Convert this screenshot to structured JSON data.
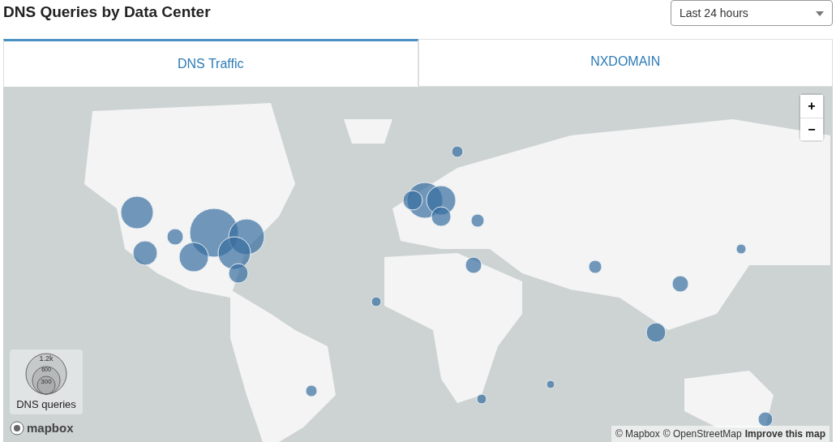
{
  "title": "DNS Queries by Data Center",
  "range_select": {
    "value": "Last 24 hours"
  },
  "tabs": [
    {
      "label": "DNS Traffic",
      "selected": true
    },
    {
      "label": "NXDOMAIN",
      "selected": false
    }
  ],
  "map": {
    "zoom_in": "+",
    "zoom_out": "−",
    "legend": {
      "sizes": [
        "1.2k",
        "600",
        "300"
      ],
      "title": "DNS queries"
    },
    "logo": "mapbox",
    "attribution": [
      "© Mapbox",
      "© OpenStreetMap"
    ],
    "improve_link": "Improve this map"
  }
}
